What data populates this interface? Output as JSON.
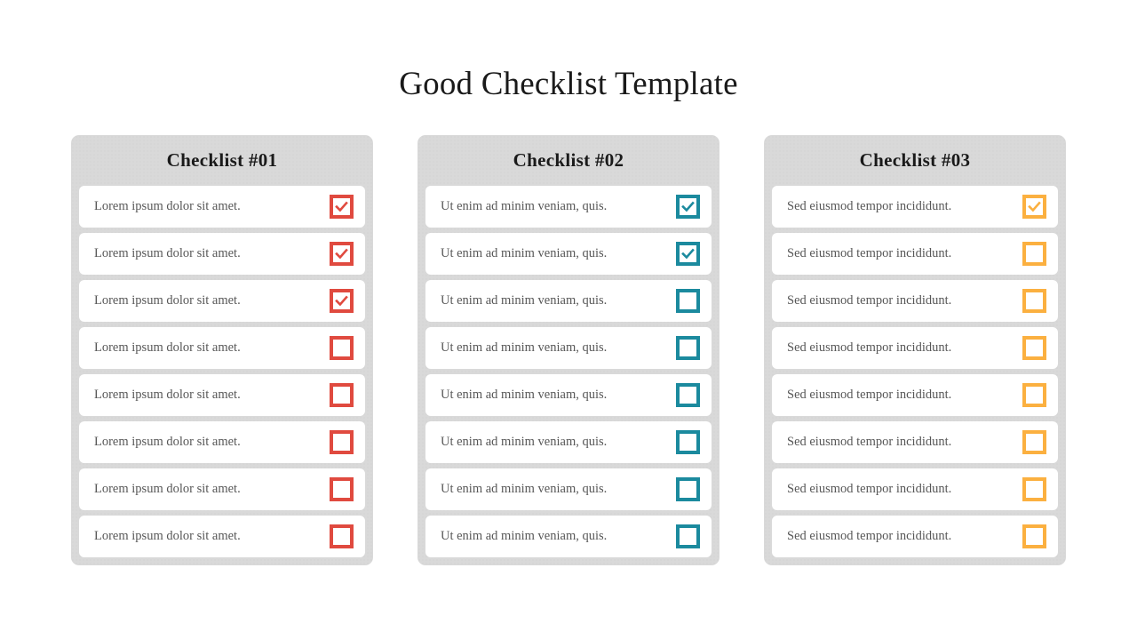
{
  "title": "Good Checklist Template",
  "colors": {
    "page_background": "#ffffff",
    "card_background": "#d9d9d9",
    "row_background": "#ffffff",
    "title_text": "#1a1a1a",
    "row_text": "#575757",
    "accent_red": "#e04a3f",
    "accent_teal": "#1b8a9e",
    "accent_orange": "#fbb040"
  },
  "columns": [
    {
      "header": "Checklist #01",
      "accent": "#e04a3f",
      "icon": "checkbox-red",
      "items": [
        {
          "label": "Lorem ipsum dolor sit amet.",
          "checked": true
        },
        {
          "label": "Lorem ipsum dolor sit amet.",
          "checked": true
        },
        {
          "label": "Lorem ipsum dolor sit amet.",
          "checked": true
        },
        {
          "label": "Lorem ipsum dolor sit amet.",
          "checked": false
        },
        {
          "label": "Lorem ipsum dolor sit amet.",
          "checked": false
        },
        {
          "label": "Lorem ipsum dolor sit amet.",
          "checked": false
        },
        {
          "label": "Lorem ipsum dolor sit amet.",
          "checked": false
        },
        {
          "label": "Lorem ipsum dolor sit amet.",
          "checked": false
        }
      ]
    },
    {
      "header": "Checklist #02",
      "accent": "#1b8a9e",
      "icon": "checkbox-teal",
      "items": [
        {
          "label": "Ut enim ad minim veniam, quis.",
          "checked": true
        },
        {
          "label": "Ut enim ad minim veniam, quis.",
          "checked": true
        },
        {
          "label": "Ut enim ad minim veniam, quis.",
          "checked": false
        },
        {
          "label": "Ut enim ad minim veniam, quis.",
          "checked": false
        },
        {
          "label": "Ut enim ad minim veniam, quis.",
          "checked": false
        },
        {
          "label": "Ut enim ad minim veniam, quis.",
          "checked": false
        },
        {
          "label": "Ut enim ad minim veniam, quis.",
          "checked": false
        },
        {
          "label": "Ut enim ad minim veniam, quis.",
          "checked": false
        }
      ]
    },
    {
      "header": "Checklist #03",
      "accent": "#fbb040",
      "icon": "checkbox-orange",
      "items": [
        {
          "label": "Sed eiusmod tempor incididunt.",
          "checked": true
        },
        {
          "label": "Sed eiusmod tempor incididunt.",
          "checked": false
        },
        {
          "label": "Sed eiusmod tempor incididunt.",
          "checked": false
        },
        {
          "label": "Sed eiusmod tempor incididunt.",
          "checked": false
        },
        {
          "label": "Sed eiusmod tempor incididunt.",
          "checked": false
        },
        {
          "label": "Sed eiusmod tempor incididunt.",
          "checked": false
        },
        {
          "label": "Sed eiusmod tempor incididunt.",
          "checked": false
        },
        {
          "label": "Sed eiusmod tempor incididunt.",
          "checked": false
        }
      ]
    }
  ]
}
